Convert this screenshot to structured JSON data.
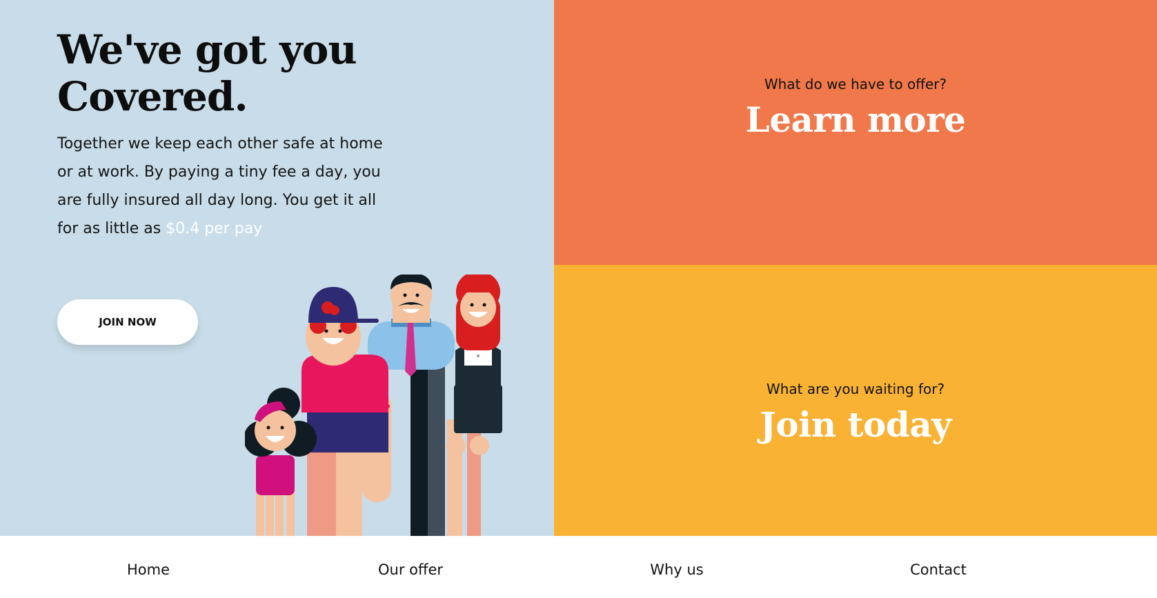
{
  "hero": {
    "title_line1": "We've got you",
    "title_line2": "Covered.",
    "text": "Together we keep each other safe at home or at work. By paying a tiny fee a day, you are fully insured all day long. You get it all for as little as ",
    "price": "$0.4 per pay",
    "join_button": "JOIN NOW",
    "illustration_icon": "family-illustration-icon"
  },
  "offer_panel": {
    "kicker": "What do we have to offer?",
    "cta": "Learn more"
  },
  "join_panel": {
    "kicker": "What are you waiting for?",
    "cta": "Join today"
  },
  "nav": {
    "items": [
      "Home",
      "Our offer",
      "Why us",
      "Contact"
    ]
  },
  "colors": {
    "hero_bg": "#c8dde9",
    "offer_bg": "#f1784a",
    "join_bg": "#f9b233",
    "accent_text": "#ffffff"
  }
}
